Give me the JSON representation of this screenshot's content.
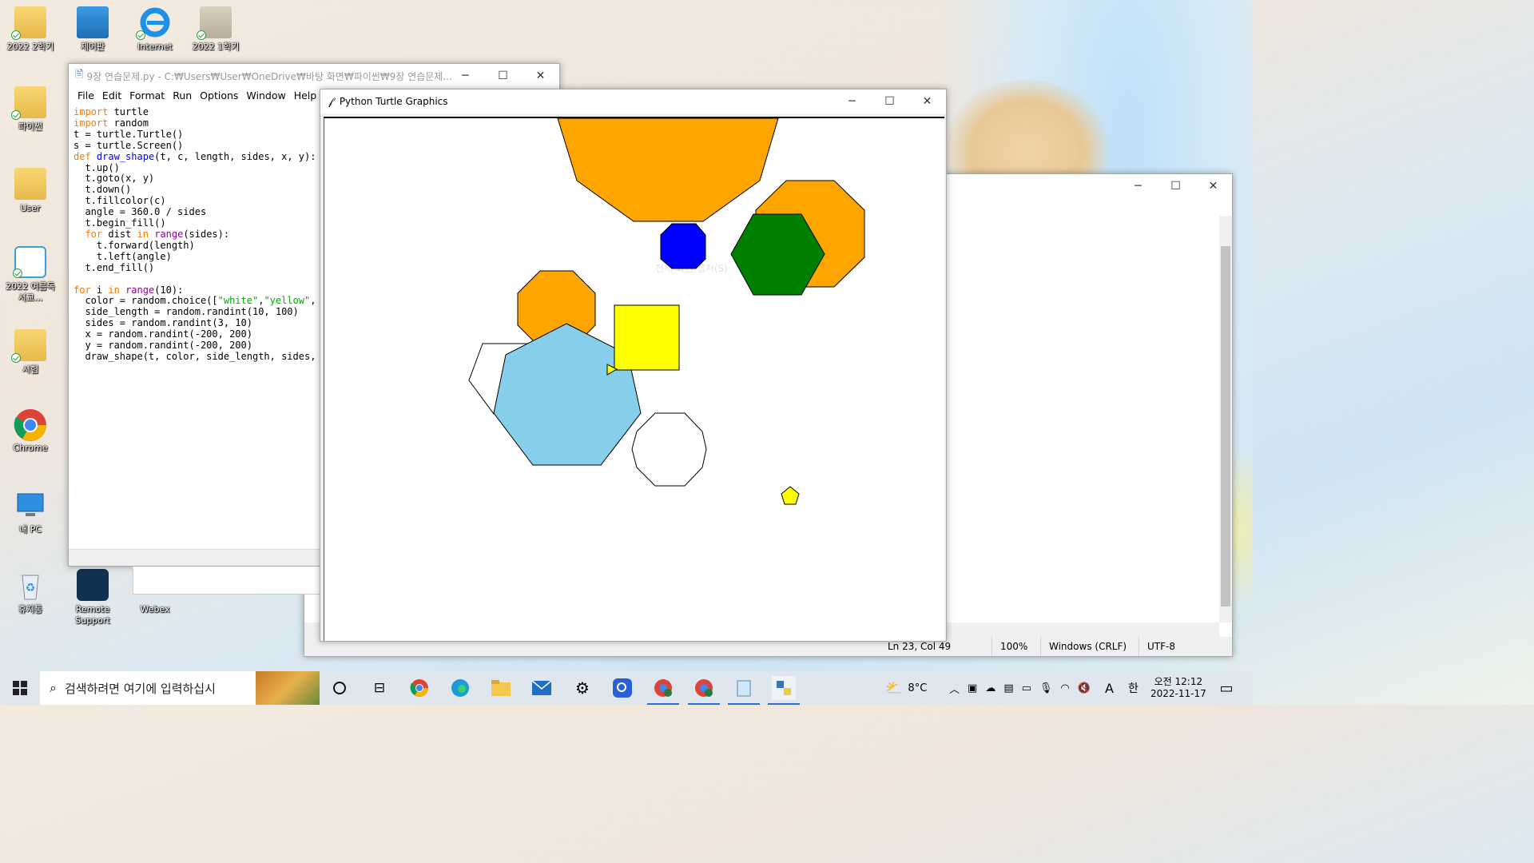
{
  "desktop": {
    "icons": [
      {
        "label": "2022 2학기"
      },
      {
        "label": "제어판"
      },
      {
        "label": "Internet"
      },
      {
        "label": "2022 1학기"
      },
      {
        "label": "파이썬"
      },
      {
        "label": "User"
      },
      {
        "label": "2022 여름독서교..."
      },
      {
        "label": "시험"
      },
      {
        "label": "Chrome"
      },
      {
        "label": "내 PC"
      },
      {
        "label": "휴지통"
      },
      {
        "label": "Remote Support"
      },
      {
        "label": "Webex"
      }
    ]
  },
  "idle": {
    "title": "9장 연습문제.py - C:₩Users₩User₩OneDrive₩바탕 화면₩파이썬₩9장 연습문제...",
    "menu": [
      "File",
      "Edit",
      "Format",
      "Run",
      "Options",
      "Window",
      "Help"
    ]
  },
  "notepad": {
    "status": {
      "position": "Ln 23, Col 49",
      "zoom": "100%",
      "eol": "Windows (CRLF)",
      "encoding": "UTF-8"
    }
  },
  "turtle": {
    "title": "Python Turtle Graphics",
    "colors": {
      "orange": "#ffa500",
      "blue": "#0000ff",
      "green": "#008000",
      "yellow": "#ffff00",
      "skyblue": "#87ceeb",
      "white": "#ffffff"
    },
    "ghost_text": "전체 화면 캡처(S)"
  },
  "taskbar": {
    "search_placeholder": "검색하려면 여기에 입력하십시",
    "weather": "8°C",
    "ime_a": "A",
    "ime_lang": "한",
    "time": "오전 12:12",
    "date": "2022-11-17"
  }
}
